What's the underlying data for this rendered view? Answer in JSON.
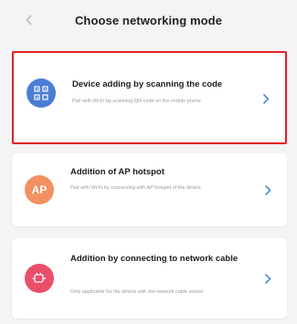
{
  "header": {
    "back_icon": "chevron-left-icon",
    "title": "Choose networking mode"
  },
  "colors": {
    "accent_blue": "#4a7ed3",
    "ap_orange": "#f39061",
    "cable_red": "#ea4f6a",
    "highlight_border": "#e21f26",
    "chevron_blue": "#3d7fd6"
  },
  "modes": [
    {
      "icon": "qr-code-icon",
      "title": "Device adding by scanning the code",
      "description": "Pair with Wi-Fi by scanning QR code on the mobile phone",
      "highlighted": true
    },
    {
      "icon": "ap-hotspot-icon",
      "icon_text": "AP",
      "title": "Addition of AP hotspot",
      "description": "Pair with Wi-Fi by connecting with AP hotspot of the device",
      "highlighted": false
    },
    {
      "icon": "network-cable-icon",
      "title": "Addition by connecting to network cable",
      "description": "Only applicable for the device with the network cable socket",
      "highlighted": false
    }
  ]
}
